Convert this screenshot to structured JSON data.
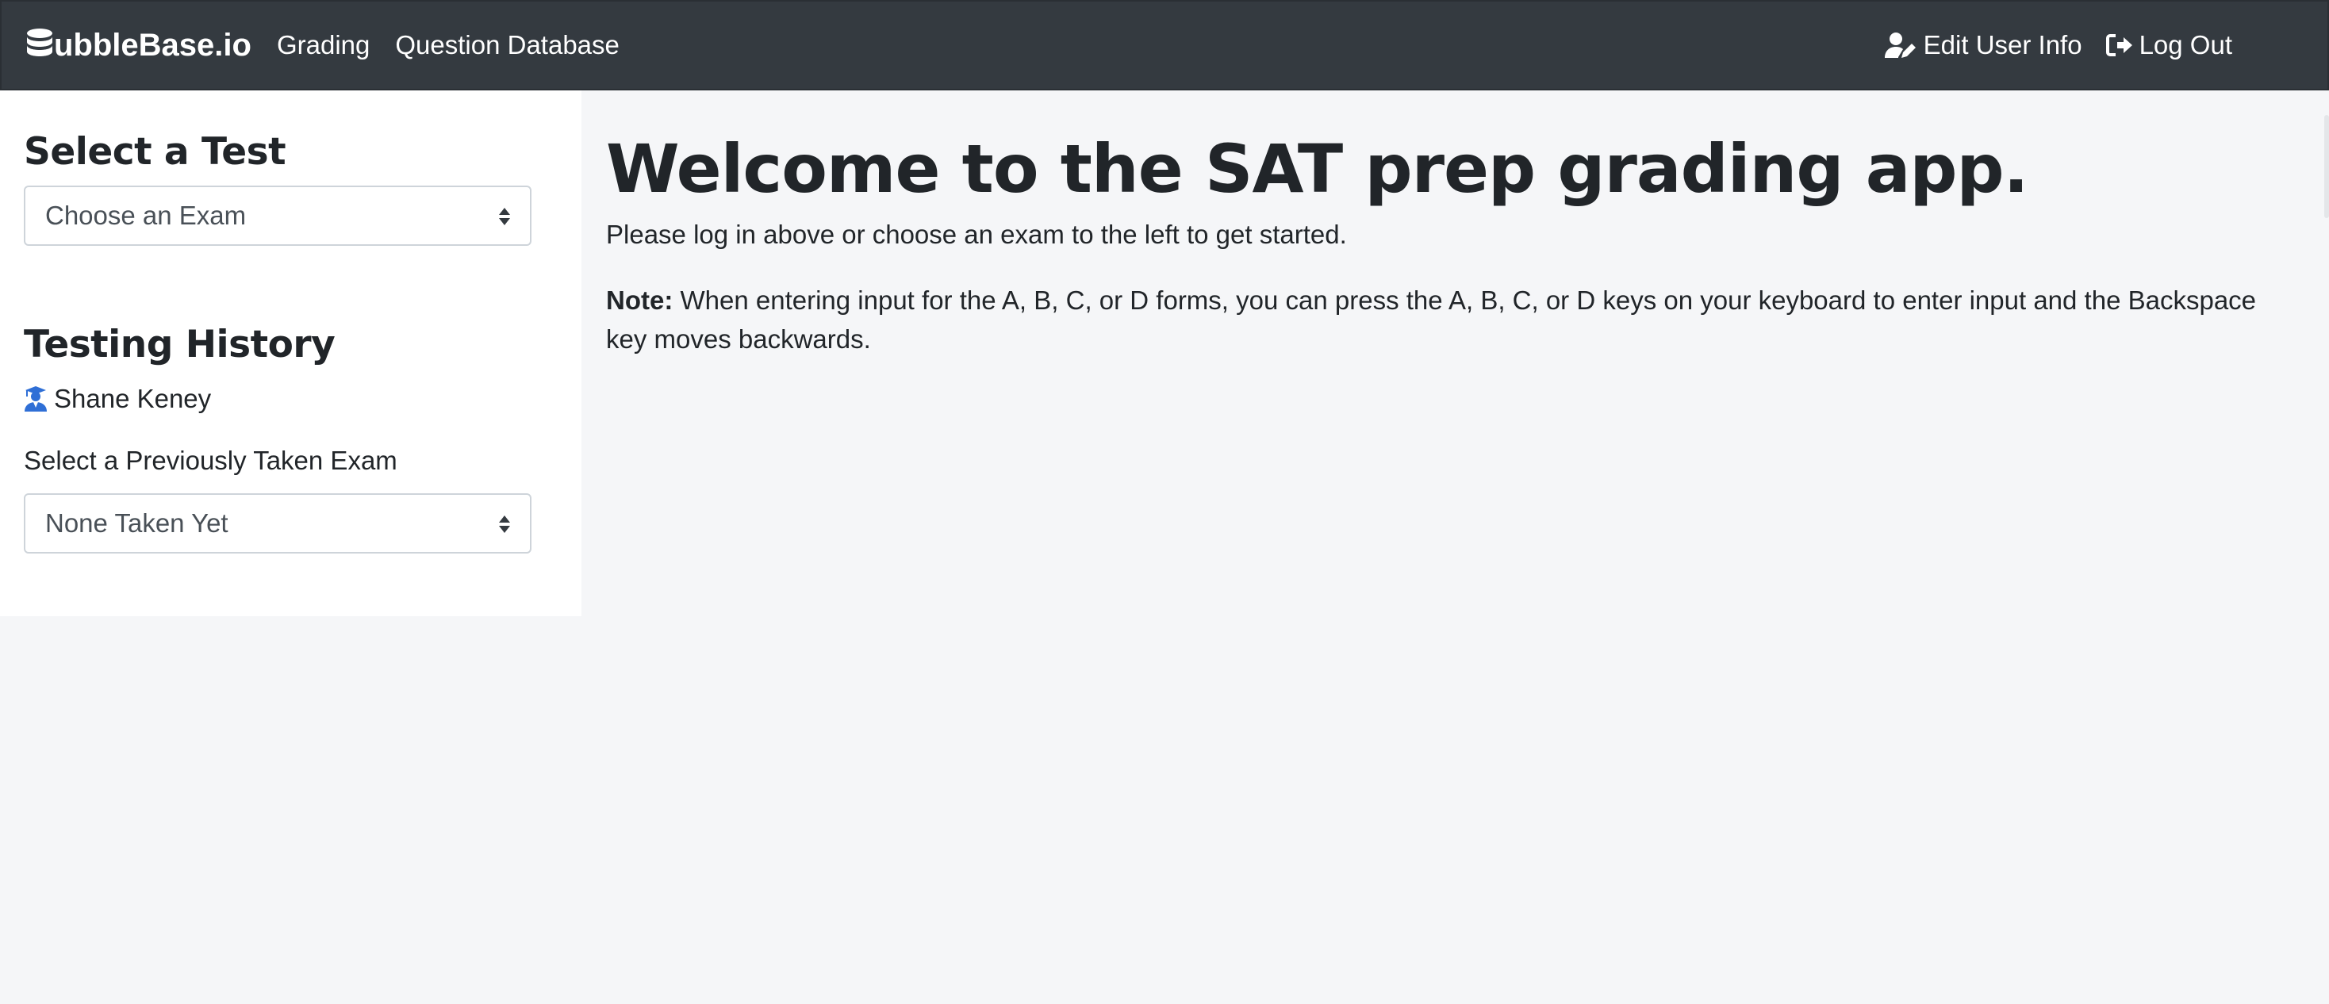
{
  "navbar": {
    "brand": "ubbleBase.io",
    "brand_icon": "database-icon",
    "links": [
      "Grading",
      "Question Database"
    ],
    "edit_user": "Edit User Info",
    "log_out": "Log Out",
    "bg_color": "#343a40"
  },
  "sidebar": {
    "select_test_heading": "Select a Test",
    "exam_select": {
      "selected": "Choose an Exam"
    },
    "history_heading": "Testing History",
    "user_name": "Shane Keney",
    "user_icon": "graduate-icon",
    "prev_label": "Select a Previously Taken Exam",
    "prev_select": {
      "selected": "None Taken Yet"
    }
  },
  "main": {
    "title": "Welcome to the SAT prep grading app.",
    "intro": "Please log in above or choose an exam to the left to get started.",
    "note_label": "Note:",
    "note_text": " When entering input for the A, B, C, or D forms, you can press the A, B, C, or D keys on your keyboard to enter input and the Backspace key moves backwards."
  }
}
